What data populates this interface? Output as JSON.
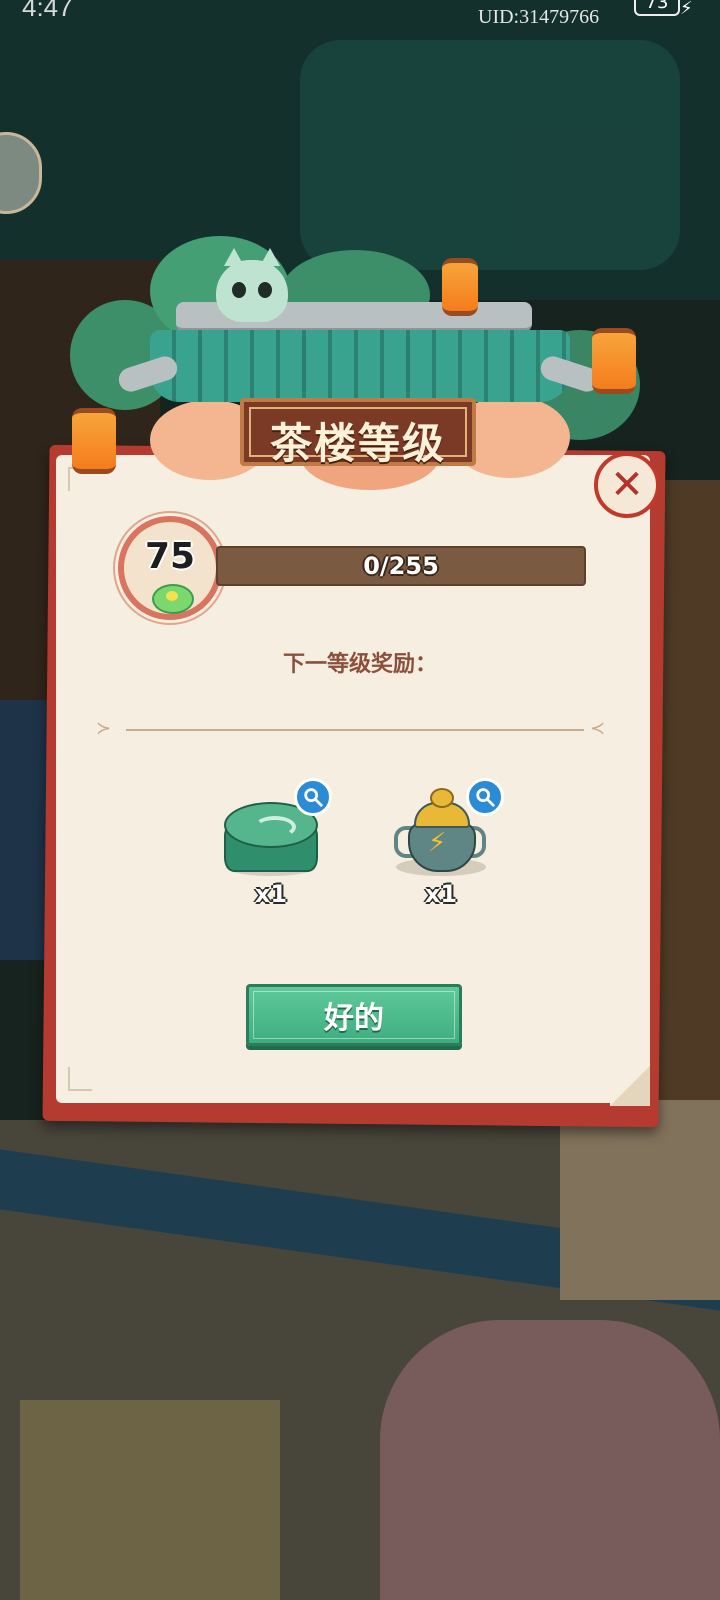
{
  "status_bar": {
    "time": "4:47",
    "uid": "UID:31479766",
    "battery": "73"
  },
  "dialog": {
    "title": "茶楼等级",
    "level": "75",
    "progress": {
      "text": "0/255",
      "current": 0,
      "max": 255
    },
    "reward_heading": "下一等级奖励：",
    "rewards": [
      {
        "icon": "green-tea-tin-icon",
        "quantity": "x1"
      },
      {
        "icon": "energy-teapot-icon",
        "quantity": "x1"
      }
    ],
    "confirm_label": "好的"
  },
  "colors": {
    "panel": "#f6efe1",
    "panel_border": "#b53a2f",
    "confirm_button": "#4dba8a",
    "progress_track": "#7b5a42",
    "roof": "#3aa38f"
  }
}
